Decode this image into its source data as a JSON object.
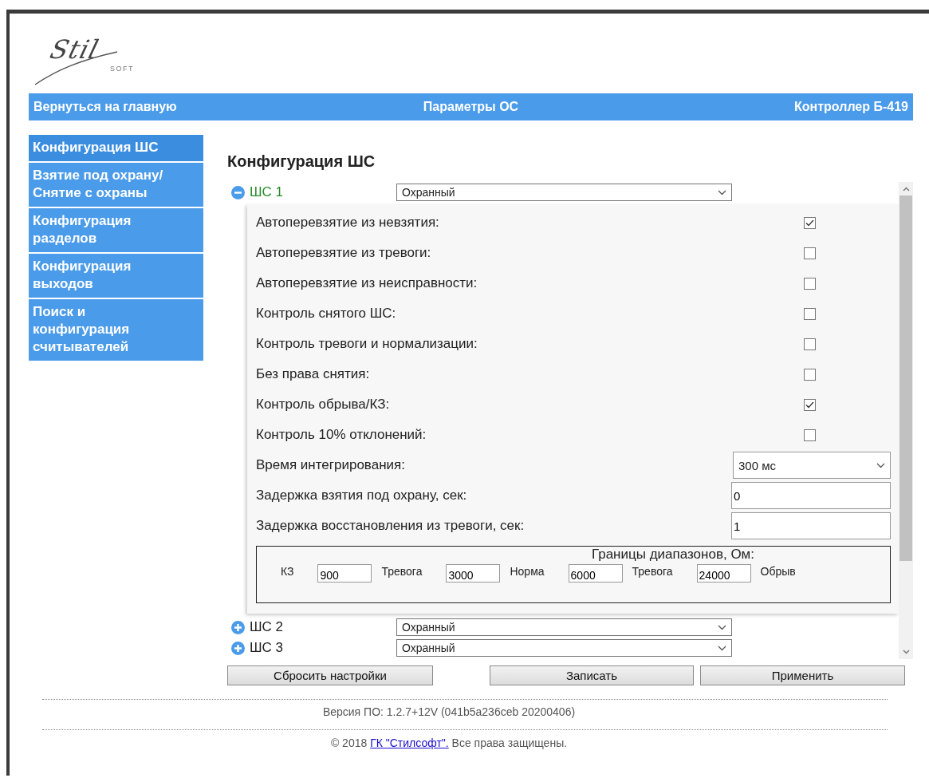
{
  "logo": {
    "text": "Stil",
    "subtext": "SOFT"
  },
  "header": {
    "back_link": "Вернуться на главную",
    "title": "Параметры ОС",
    "device": "Контроллер Б-419"
  },
  "sidebar": {
    "items": [
      {
        "label": "Конфигурация ШС",
        "selected": true
      },
      {
        "label": "Взятие под охрану/ Снятие с охраны",
        "selected": false
      },
      {
        "label": "Конфигурация разделов",
        "selected": false
      },
      {
        "label": "Конфигурация выходов",
        "selected": false
      },
      {
        "label": "Поиск и конфигурация считывателей",
        "selected": false
      }
    ]
  },
  "page_title": "Конфигурация ШС",
  "loops": [
    {
      "label": "ШС 1",
      "expanded": true,
      "type": "Охранный",
      "settings": [
        {
          "kind": "checkbox",
          "label": "Автоперевзятие из невзятия:",
          "checked": true
        },
        {
          "kind": "checkbox",
          "label": "Автоперевзятие из тревоги:",
          "checked": false
        },
        {
          "kind": "checkbox",
          "label": "Автоперевзятие из неисправности:",
          "checked": false
        },
        {
          "kind": "checkbox",
          "label": "Контроль снятого ШС:",
          "checked": false
        },
        {
          "kind": "checkbox",
          "label": "Контроль тревоги и нормализации:",
          "checked": false
        },
        {
          "kind": "checkbox",
          "label": "Без права снятия:",
          "checked": false
        },
        {
          "kind": "checkbox",
          "label": "Контроль обрыва/КЗ:",
          "checked": true
        },
        {
          "kind": "checkbox",
          "label": "Контроль 10% отклонений:",
          "checked": false
        },
        {
          "kind": "select",
          "label": "Время интегрирования:",
          "value": "300 мс"
        },
        {
          "kind": "input",
          "label": "Задержка взятия под охрану, сек:",
          "value": "0"
        },
        {
          "kind": "input",
          "label": "Задержка восстановления из тревоги, сек:",
          "value": "1"
        }
      ],
      "ranges": {
        "title": "Границы диапазонов, Ом:",
        "items": [
          {
            "kind": "label",
            "text": "КЗ"
          },
          {
            "kind": "input",
            "value": "900"
          },
          {
            "kind": "label",
            "text": "Тревога"
          },
          {
            "kind": "input",
            "value": "3000"
          },
          {
            "kind": "label",
            "text": "Норма"
          },
          {
            "kind": "input",
            "value": "6000"
          },
          {
            "kind": "label",
            "text": "Тревога"
          },
          {
            "kind": "input",
            "value": "24000"
          },
          {
            "kind": "label",
            "text": "Обрыв"
          }
        ]
      }
    },
    {
      "label": "ШС 2",
      "expanded": false,
      "type": "Охранный"
    },
    {
      "label": "ШС 3",
      "expanded": false,
      "type": "Охранный"
    }
  ],
  "buttons": [
    "Сбросить настройки",
    "Записать",
    "Применить"
  ],
  "footer": {
    "version": "Версия ПО: 1.2.7+12V (041b5a236ceb 20200406)",
    "copyright_prefix": "© 2018 ",
    "copyright_link": "ГК \"Стилсофт\".",
    "copyright_suffix": " Все права защищены."
  }
}
